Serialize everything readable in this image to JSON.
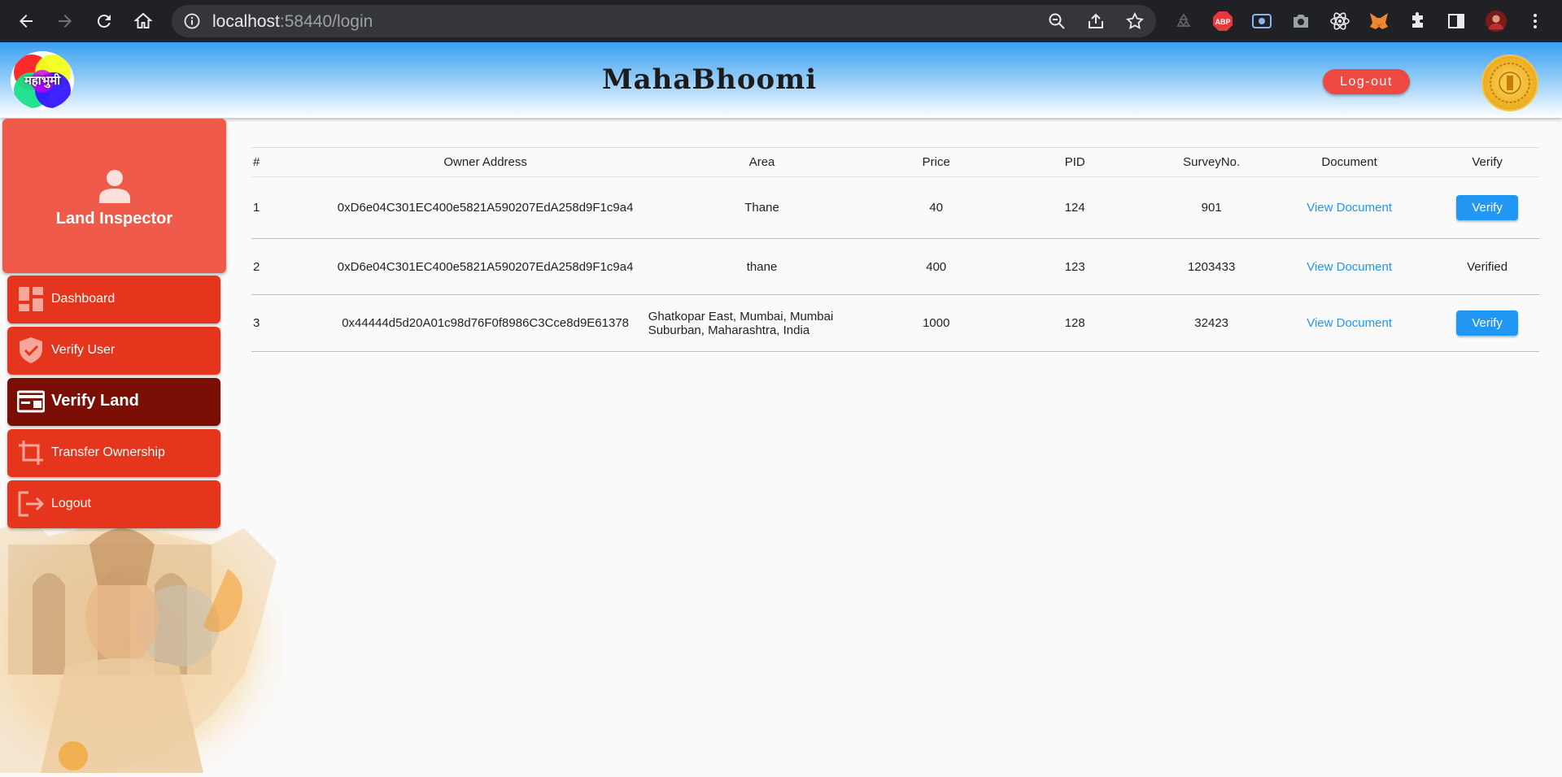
{
  "browser": {
    "url_host": "localhost",
    "url_rest": ":58440/login"
  },
  "header": {
    "logo_text": "महाभुमी",
    "title": "MahaBhoomi",
    "logout_label": "Log-out"
  },
  "sidebar": {
    "role": "Land Inspector",
    "items": [
      {
        "label": "Dashboard",
        "icon": "dashboard-icon"
      },
      {
        "label": "Verify User",
        "icon": "verified-shield-icon"
      },
      {
        "label": "Verify Land",
        "icon": "land-card-icon",
        "active": true
      },
      {
        "label": "Transfer Ownership",
        "icon": "transfer-crop-icon"
      },
      {
        "label": "Logout",
        "icon": "logout-icon"
      }
    ]
  },
  "table": {
    "headers": [
      "#",
      "Owner Address",
      "Area",
      "Price",
      "PID",
      "SurveyNo.",
      "Document",
      "Verify"
    ],
    "rows": [
      {
        "num": "1",
        "owner": "0xD6e04C301EC400e5821A590207EdA258d9F1c9a4",
        "area": "Thane",
        "price": "40",
        "pid": "124",
        "survey": "901",
        "document": "View Document",
        "verify": "Verify"
      },
      {
        "num": "2",
        "owner": "0xD6e04C301EC400e5821A590207EdA258d9F1c9a4",
        "area": "thane",
        "price": "400",
        "pid": "123",
        "survey": "1203433",
        "document": "View Document",
        "verify": "Verified"
      },
      {
        "num": "3",
        "owner": "0x44444d5d20A01c98d76F0f8986C3Cce8d9E61378",
        "area": "Ghatkopar East, Mumbai, Mumbai Suburban, Maharashtra, India",
        "price": "1000",
        "pid": "128",
        "survey": "32423",
        "document": "View Document",
        "verify": "Verify"
      }
    ]
  },
  "colors": {
    "accent_blue": "#2196f3",
    "nav_red": "#e5351d",
    "nav_active": "#7b0e05",
    "profile_red": "#f05a4a",
    "logout_red": "#ee4a43"
  }
}
